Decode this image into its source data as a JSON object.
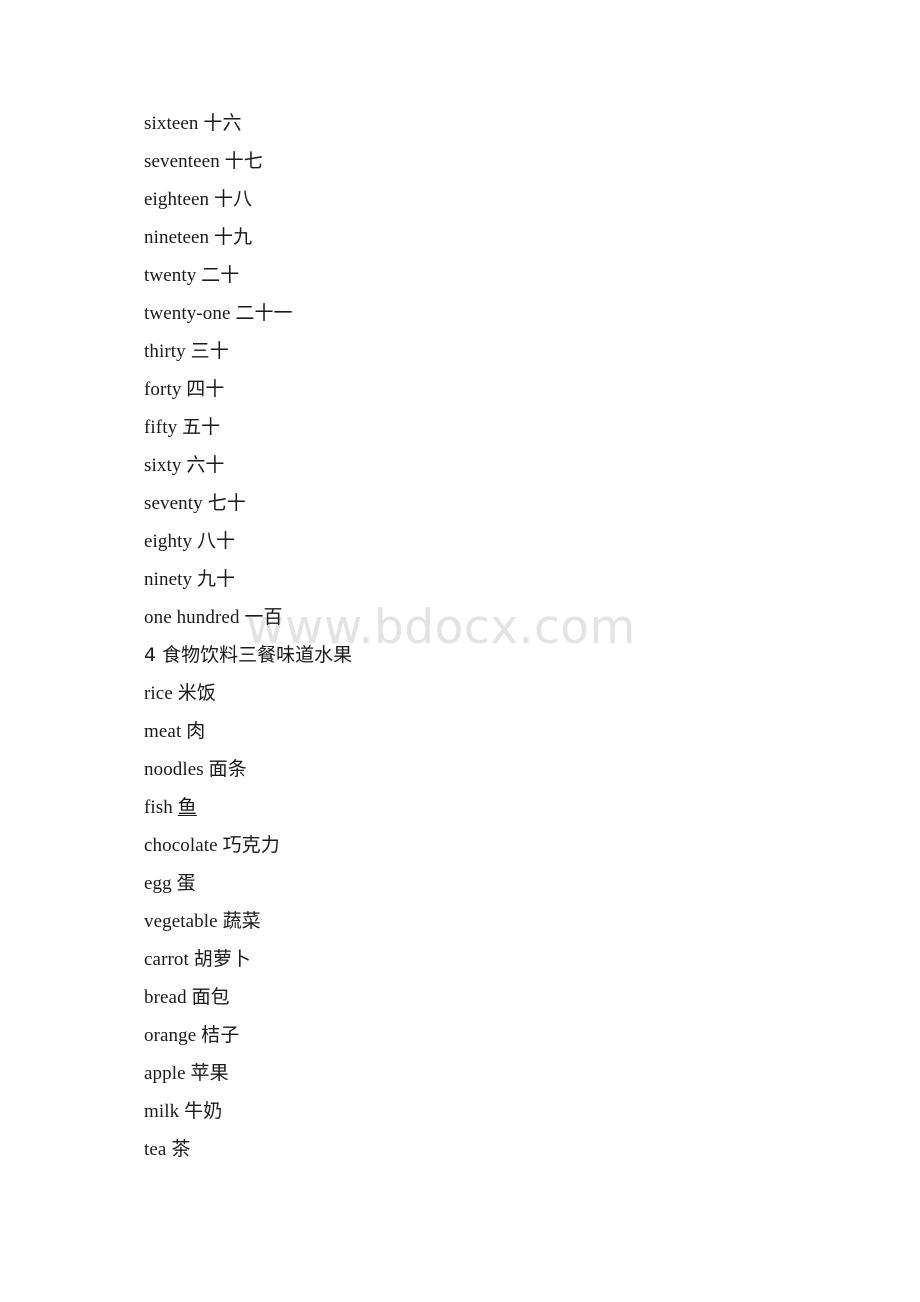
{
  "document": {
    "page_background": "#ffffff",
    "text_color": "#1a1a1a"
  },
  "watermark": {
    "text": "www.bdocx.com",
    "color": "#e3e3e3"
  },
  "body_lines": [
    {
      "kind": "entry",
      "english": "sixteen",
      "chinese": "十六",
      "underlined": false
    },
    {
      "kind": "entry",
      "english": "seventeen",
      "chinese": "十七",
      "underlined": false
    },
    {
      "kind": "entry",
      "english": "eighteen",
      "chinese": "十八",
      "underlined": false
    },
    {
      "kind": "entry",
      "english": "nineteen",
      "chinese": "十九",
      "underlined": false
    },
    {
      "kind": "entry",
      "english": "twenty",
      "chinese": "二十",
      "underlined": false
    },
    {
      "kind": "entry",
      "english": "twenty-one",
      "chinese": "二十一",
      "underlined": false
    },
    {
      "kind": "entry",
      "english": "thirty",
      "chinese": "三十",
      "underlined": false
    },
    {
      "kind": "entry",
      "english": "forty",
      "chinese": "四十",
      "underlined": false
    },
    {
      "kind": "entry",
      "english": "fifty",
      "chinese": "五十",
      "underlined": false
    },
    {
      "kind": "entry",
      "english": "sixty",
      "chinese": "六十",
      "underlined": false
    },
    {
      "kind": "entry",
      "english": "seventy",
      "chinese": "七十",
      "underlined": false
    },
    {
      "kind": "entry",
      "english": "eighty",
      "chinese": "八十",
      "underlined": false
    },
    {
      "kind": "entry",
      "english": "ninety",
      "chinese": "九十",
      "underlined": false
    },
    {
      "kind": "entry",
      "english": "one hundred",
      "chinese": "一百",
      "underlined": false
    },
    {
      "kind": "heading",
      "text": "4 食物饮料三餐味道水果"
    },
    {
      "kind": "entry",
      "english": "rice",
      "chinese": "米饭",
      "underlined": false
    },
    {
      "kind": "entry",
      "english": "meat",
      "chinese": "肉",
      "underlined": false
    },
    {
      "kind": "entry",
      "english": "noodles",
      "chinese": "面条",
      "underlined": false
    },
    {
      "kind": "entry",
      "english": "fish",
      "chinese": "鱼",
      "underlined": true
    },
    {
      "kind": "entry",
      "english": "chocolate",
      "chinese": "巧克力",
      "underlined": false
    },
    {
      "kind": "entry",
      "english": "egg",
      "chinese": "蛋",
      "underlined": false
    },
    {
      "kind": "entry",
      "english": "vegetable",
      "chinese": "蔬菜",
      "underlined": false
    },
    {
      "kind": "entry",
      "english": "carrot",
      "chinese": "胡萝卜",
      "underlined": false
    },
    {
      "kind": "entry",
      "english": "bread",
      "chinese": "面包",
      "underlined": false
    },
    {
      "kind": "entry",
      "english": "orange",
      "chinese": "桔子",
      "underlined": false
    },
    {
      "kind": "entry",
      "english": "apple",
      "chinese": "苹果",
      "underlined": false
    },
    {
      "kind": "entry",
      "english": "milk",
      "chinese": "牛奶",
      "underlined": false
    },
    {
      "kind": "entry",
      "english": "tea",
      "chinese": "茶",
      "underlined": false
    }
  ]
}
